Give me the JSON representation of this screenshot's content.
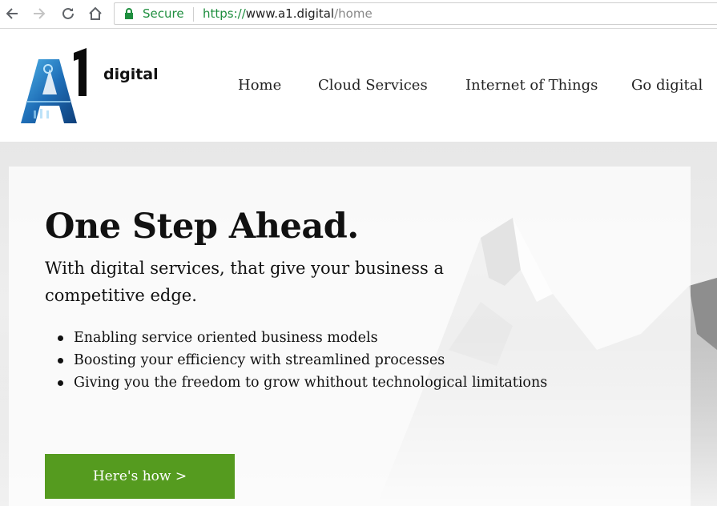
{
  "browser": {
    "secure_label": "Secure",
    "url_protocol": "https://",
    "url_host": "www.a1.digital",
    "url_path": "/home",
    "secure_color": "#1e8e3e"
  },
  "site": {
    "logo_text": "digital",
    "logo_numeral": "1",
    "logo_letter": "A",
    "nav": [
      {
        "label": "Home"
      },
      {
        "label": "Cloud Services"
      },
      {
        "label": "Internet of Things"
      },
      {
        "label": "Go digital"
      }
    ]
  },
  "hero": {
    "title": "One Step Ahead.",
    "subtitle": "With digital services, that give your business a competitive edge.",
    "bullets": [
      "Enabling service oriented business models",
      "Boosting your efficiency with streamlined processes",
      "Giving you the freedom to grow whithout technological limitations"
    ],
    "cta_label": "Here's how >",
    "cta_color": "#559b1f"
  }
}
